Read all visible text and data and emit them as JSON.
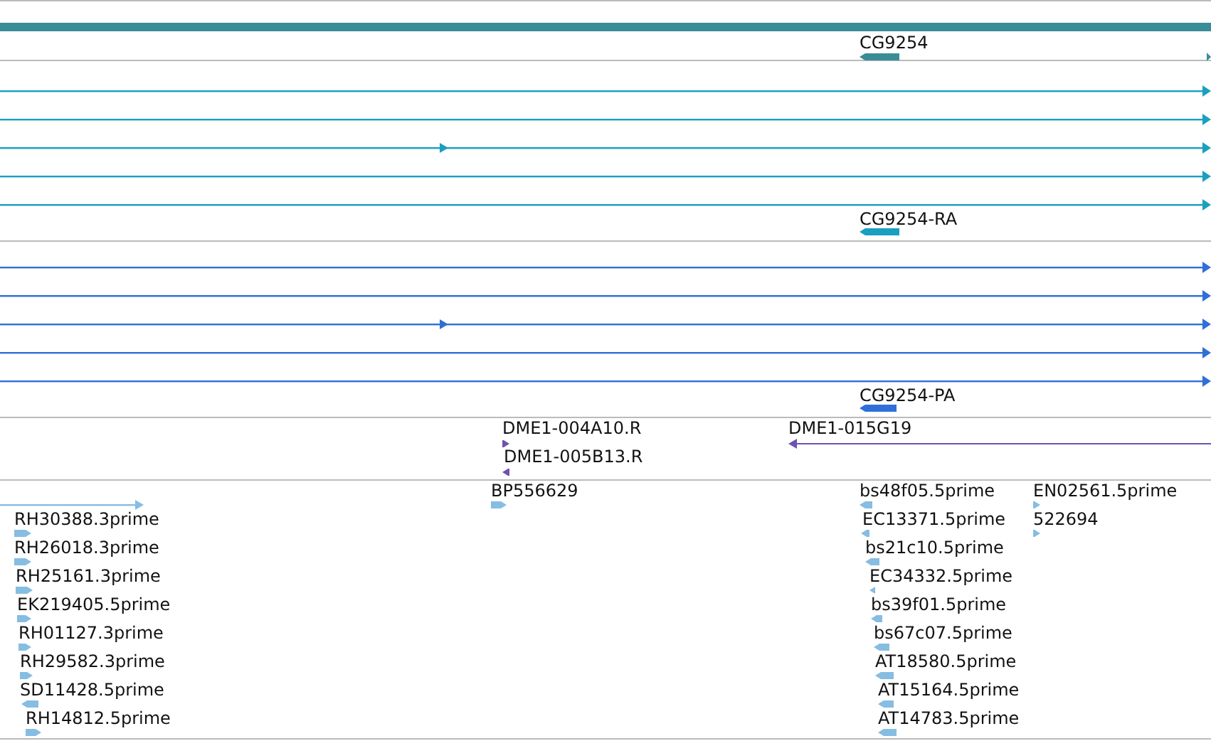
{
  "tracks": [
    {
      "kind": "gene",
      "features": [
        {
          "label": "CG9254",
          "reverse": true
        }
      ]
    },
    {
      "kind": "transcript",
      "features": [
        {
          "label": "CG9254-RA",
          "reverse": true
        }
      ]
    },
    {
      "kind": "protein",
      "features": [
        {
          "label": "CG9254-PA",
          "reverse": true
        }
      ]
    },
    {
      "kind": "clone",
      "features": [
        {
          "label": "DME1-004A10.R",
          "reverse": false
        },
        {
          "label": "DME1-005B13.R",
          "reverse": true
        },
        {
          "label": "DME1-015G19",
          "reverse": true
        }
      ]
    },
    {
      "kind": "est",
      "features": [
        {
          "label": "BP556629",
          "reverse": false
        },
        {
          "label": "RH30388.3prime",
          "reverse": false
        },
        {
          "label": "RH26018.3prime",
          "reverse": false
        },
        {
          "label": "RH25161.3prime",
          "reverse": false
        },
        {
          "label": "EK219405.5prime",
          "reverse": false
        },
        {
          "label": "RH01127.3prime",
          "reverse": false
        },
        {
          "label": "RH29582.3prime",
          "reverse": false
        },
        {
          "label": "SD11428.5prime",
          "reverse": true
        },
        {
          "label": "RH14812.5prime",
          "reverse": false
        },
        {
          "label": "bs48f05.5prime",
          "reverse": true
        },
        {
          "label": "EC13371.5prime",
          "reverse": true
        },
        {
          "label": "bs21c10.5prime",
          "reverse": true
        },
        {
          "label": "EC34332.5prime",
          "reverse": true
        },
        {
          "label": "bs39f01.5prime",
          "reverse": true
        },
        {
          "label": "bs67c07.5prime",
          "reverse": true
        },
        {
          "label": "AT18580.5prime",
          "reverse": true
        },
        {
          "label": "AT15164.5prime",
          "reverse": true
        },
        {
          "label": "AT14783.5prime",
          "reverse": true
        },
        {
          "label": "EN02561.5prime",
          "reverse": false
        },
        {
          "label": "522694",
          "reverse": false
        }
      ]
    }
  ]
}
